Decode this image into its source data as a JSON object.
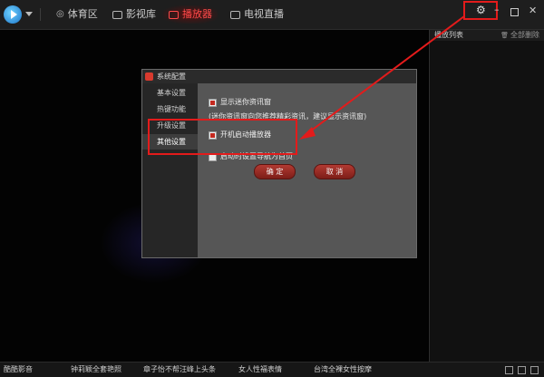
{
  "topbar": {
    "tabs": [
      {
        "label": "体育区"
      },
      {
        "label": "影视库"
      },
      {
        "label": "播放器"
      },
      {
        "label": "电视直播"
      }
    ]
  },
  "sidebar": {
    "title": "播放列表",
    "clear_all": "全部删除"
  },
  "dialog": {
    "title": "系统配置",
    "nav": [
      {
        "label": "基本设置"
      },
      {
        "label": "热键功能"
      },
      {
        "label": "升级设置"
      },
      {
        "label": "其他设置"
      }
    ],
    "options": [
      {
        "label": "显示迷你资讯窗",
        "checked": true
      },
      {
        "label": "开机启动播放器",
        "checked": true
      },
      {
        "label": "启动时设置导航为首页",
        "checked": false
      }
    ],
    "hint": "(迷你资讯窗向您推荐精彩资讯，建议显示资讯窗)",
    "ok_label": "确 定",
    "cancel_label": "取 消"
  },
  "ticker": {
    "items": [
      "酷酷影音",
      "钟莉颖全套艳照",
      "章子怡不帮汪峰上头条",
      "女人性福表情",
      "台湾全裸女性按摩"
    ]
  },
  "colors": {
    "accent_red": "#e31b1b",
    "active_tab": "#ff4a4a",
    "button_red": "#b23a32"
  }
}
